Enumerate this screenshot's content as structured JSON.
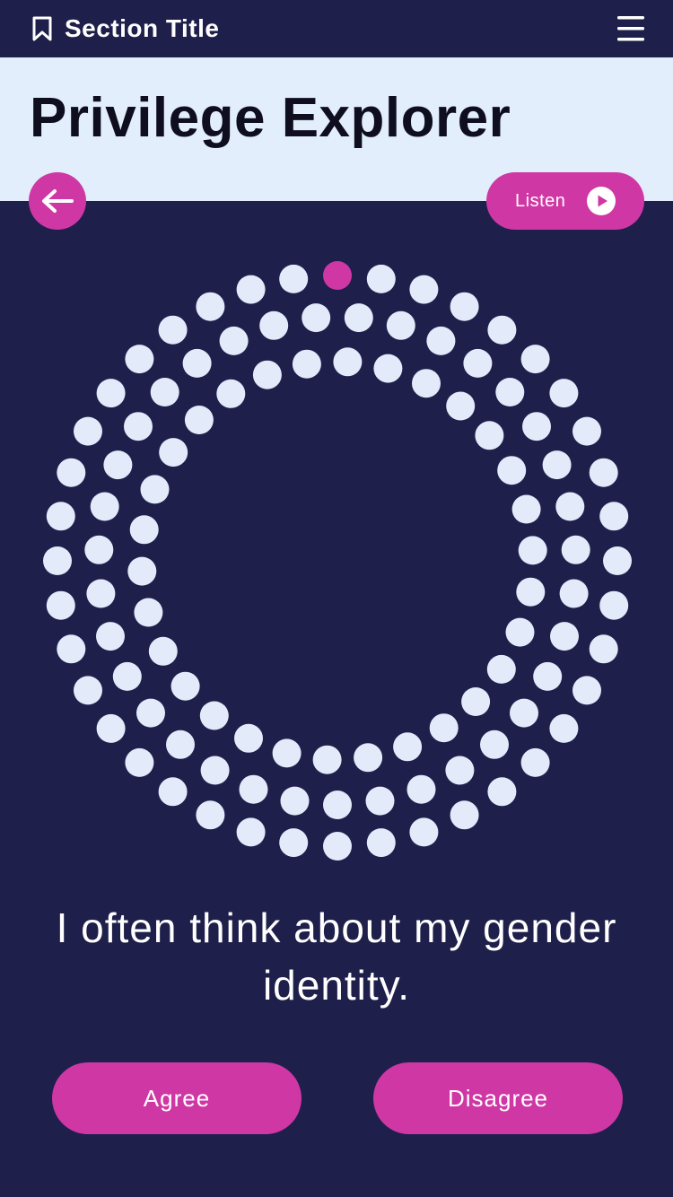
{
  "topbar": {
    "section_title": "Section Title",
    "bookmark_icon": "bookmark-icon",
    "menu_icon": "hamburger-menu-icon"
  },
  "header": {
    "title": "Privilege Explorer"
  },
  "controls": {
    "back_icon": "arrow-left-icon",
    "listen_label": "Listen",
    "listen_icon": "play-icon"
  },
  "progress": {
    "current_question": 1,
    "total_questions": 105,
    "active_color": "#cf37a4",
    "inactive_color": "#e3eafa"
  },
  "question": {
    "text": "I often think about my gender identity."
  },
  "answers": {
    "agree_label": "Agree",
    "disagree_label": "Disagree"
  },
  "colors": {
    "background": "#1f1f4b",
    "header_band": "#e3eefc",
    "accent": "#cf37a4",
    "title_text": "#0e0e1e"
  }
}
